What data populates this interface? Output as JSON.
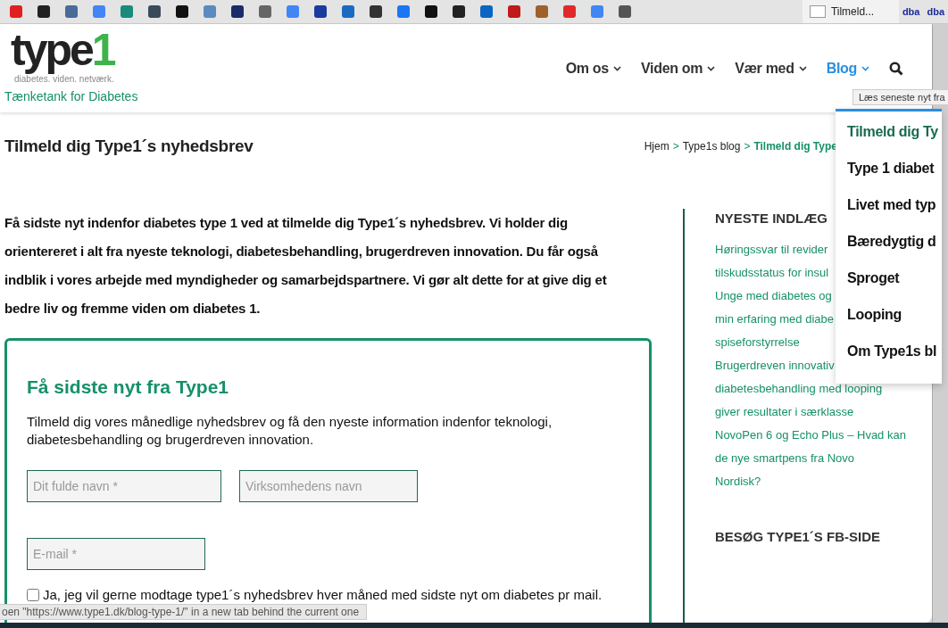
{
  "bookmarks_bar": {
    "bookmarks": [
      {
        "color": "#e02020"
      },
      {
        "color": "#222222"
      },
      {
        "color": "#4a6a9a"
      },
      {
        "color": "#4285f4"
      },
      {
        "color": "#1a8a7a"
      },
      {
        "color": "#3a4a5a"
      },
      {
        "color": "#111111"
      },
      {
        "color": "#5a8ac0"
      },
      {
        "color": "#1a2a6a"
      },
      {
        "color": "#666666"
      },
      {
        "color": "#4285f4"
      },
      {
        "color": "#1a3aa0"
      },
      {
        "color": "#1a6ac0"
      },
      {
        "color": "#333333"
      },
      {
        "color": "#1877f2"
      },
      {
        "color": "#111111"
      },
      {
        "color": "#222222"
      },
      {
        "color": "#0a66c2"
      },
      {
        "color": "#c01a1a"
      },
      {
        "color": "#a0602a"
      },
      {
        "color": "#e02a2a"
      },
      {
        "color": "#4285f4"
      },
      {
        "color": "#555555"
      }
    ],
    "tab": {
      "title": "Tilmeld..."
    },
    "extras": [
      {
        "label": "dba"
      },
      {
        "label": "dba"
      }
    ]
  },
  "header": {
    "logo": {
      "word": "type",
      "digit": "1",
      "tagline": "diabetes. viden. netværk."
    },
    "slogan": "Tænketank for Diabetes",
    "nav": [
      {
        "label": "Om os",
        "selected": false
      },
      {
        "label": "Viden om",
        "selected": false
      },
      {
        "label": "Vær med",
        "selected": false
      },
      {
        "label": "Blog",
        "selected": true
      }
    ],
    "tooltip": "Læs seneste nyt fra"
  },
  "dropdown": {
    "items": [
      {
        "label": "Tilmeld dig Ty",
        "selected": true
      },
      {
        "label": "Type 1 diabet",
        "selected": false
      },
      {
        "label": "Livet med typ",
        "selected": false
      },
      {
        "label": "Bæredygtig d",
        "selected": false
      },
      {
        "label": "Sproget",
        "selected": false
      },
      {
        "label": "Looping",
        "selected": false
      },
      {
        "label": "Om Type1s bl",
        "selected": false
      }
    ]
  },
  "title_bar": {
    "title": "Tilmeld dig Type1´s nyhedsbrev",
    "breadcrumb": [
      {
        "label": "Hjem",
        "current": false
      },
      {
        "label": "Type1s blog",
        "current": false
      },
      {
        "label": "Tilmeld dig Type",
        "current": true
      }
    ],
    "separator": ">"
  },
  "intro": "Få sidste nyt indenfor diabetes type 1 ved at tilmelde dig Type1´s nyhedsbrev. Vi holder dig orientereret i alt fra nyeste teknologi, diabetesbehandling, brugerdreven innovation. Du får også indblik i vores arbejde med myndigheder og samarbejdspartnere. Vi gør alt dette for at give dig et bedre liv og fremme viden om diabetes 1.",
  "form": {
    "title": "Få sidste nyt fra Type1",
    "text": "Tilmeld dig vores månedlige nyhedsbrev og få den nyeste information indenfor teknologi, diabetesbehandling og brugerdreven innovation.",
    "name_field": {
      "placeholder": "Dit fulde navn *"
    },
    "company_field": {
      "placeholder": "Virksomhedens navn"
    },
    "email_field": {
      "placeholder": "E-mail *"
    },
    "consent": {
      "label": "Ja, jeg vil gerne modtage type1´s nyhedsbrev hver måned med sidste nyt om diabetes pr mail.",
      "checked": false
    }
  },
  "sidebar": {
    "recent_heading": "NYESTE INDLÆG",
    "posts": [
      {
        "lines": [
          "Høringssvar til revider",
          "tilskudsstatus for insul"
        ]
      },
      {
        "lines": [
          "Unge med diabetes og",
          "min erfaring med diabe",
          "spiseforstyrrelse"
        ]
      },
      {
        "lines": [
          "Brugerdreven innovativ",
          "diabetesbehandling med looping",
          "giver resultater i særklasse"
        ]
      },
      {
        "lines": [
          "NovoPen 6 og Echo Plus – Hvad kan",
          "de nye smartpens fra Novo",
          "Nordisk?"
        ]
      }
    ],
    "fb_heading": "BESØG TYPE1´S FB-SIDE"
  },
  "status_bar": {
    "text": "oen \"https://www.type1.dk/blog-type-1/\" in a new tab behind the current one"
  }
}
